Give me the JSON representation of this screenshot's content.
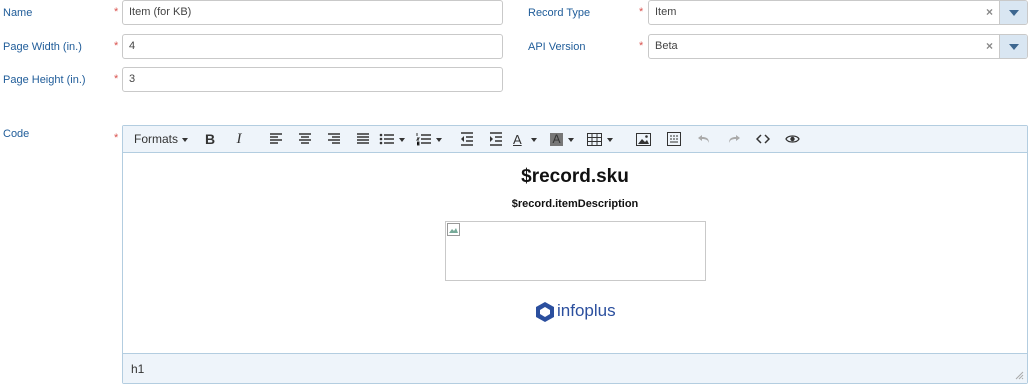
{
  "form": {
    "name": {
      "label": "Name",
      "value": "Item (for KB)"
    },
    "page_width": {
      "label": "Page Width (in.)",
      "value": "4"
    },
    "page_height": {
      "label": "Page Height (in.)",
      "value": "3"
    },
    "record_type": {
      "label": "Record Type",
      "value": "Item",
      "clear": "×"
    },
    "api_version": {
      "label": "API Version",
      "value": "Beta",
      "clear": "×"
    },
    "code": {
      "label": "Code"
    },
    "required_marker": "*"
  },
  "editor": {
    "toolbar": {
      "formats_label": "Formats"
    },
    "content": {
      "heading": "$record.sku",
      "subheading": "$record.itemDescription",
      "logo_text": "infoplus"
    },
    "status": {
      "path": "h1"
    }
  },
  "colors": {
    "label": "#1f5c99",
    "required": "#d9534f",
    "toolbar_bg": "#eef4fa",
    "logo": "#2b4f9e"
  }
}
